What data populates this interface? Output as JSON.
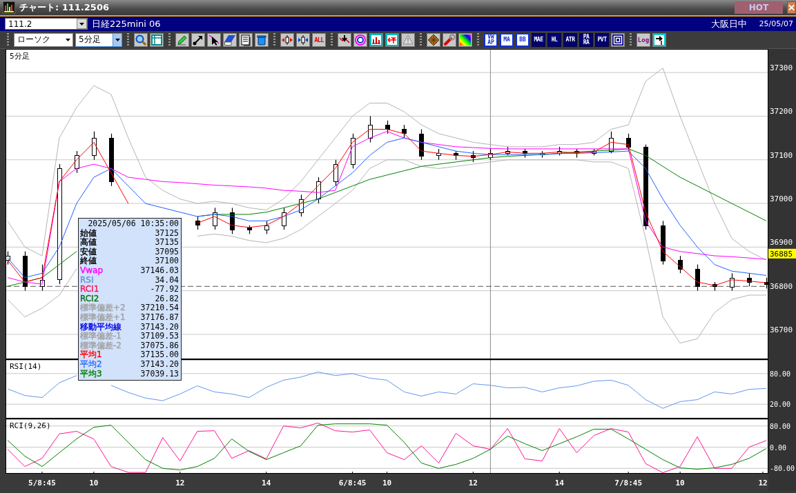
{
  "window": {
    "title": "チャート: 111.2506",
    "hot_button": "HOT"
  },
  "symbol_bar": {
    "symbol": "111.2",
    "name": "日経225mini 06",
    "session": "大阪日中",
    "date": "25/05/07"
  },
  "toolbar": {
    "dropdowns": [
      {
        "value": "ローソク",
        "focused": false
      },
      {
        "value": "5分足",
        "focused": true
      }
    ],
    "groups": [
      [
        {
          "kind": "icon"
        },
        {
          "kind": "icon"
        }
      ],
      [
        {
          "kind": "icon"
        },
        {
          "kind": "icon"
        },
        {
          "kind": "icon"
        },
        {
          "kind": "icon"
        },
        {
          "kind": "icon"
        },
        {
          "kind": "icon"
        }
      ],
      [
        {
          "kind": "icon"
        },
        {
          "kind": "icon"
        },
        {
          "kind": "warn",
          "label": "ALL"
        }
      ],
      [
        {
          "kind": "icon"
        },
        {
          "kind": "icon"
        },
        {
          "kind": "icon"
        },
        {
          "kind": "icon"
        },
        {
          "kind": "icon"
        }
      ],
      [
        {
          "kind": "icon"
        },
        {
          "kind": "icon"
        },
        {
          "kind": "icon"
        }
      ],
      [
        {
          "kind": "boxed",
          "label": "VW AP"
        },
        {
          "kind": "boxed",
          "label": "MA"
        },
        {
          "kind": "boxed",
          "label": "BB"
        },
        {
          "kind": "dark",
          "label": "MAE"
        },
        {
          "kind": "dark",
          "label": "HL"
        },
        {
          "kind": "dark",
          "label": "ATR"
        },
        {
          "kind": "dark",
          "label": "PA RA"
        },
        {
          "kind": "dark",
          "label": "PVT"
        },
        {
          "kind": "icon"
        }
      ],
      [
        {
          "kind": "plain",
          "label": "Log"
        },
        {
          "kind": "icon"
        }
      ]
    ]
  },
  "main_chart": {
    "chart_data": {
      "type": "candlestick",
      "title": "5分足",
      "grid": true,
      "categories": [
        null,
        null,
        null,
        null,
        null,
        null,
        null,
        null,
        null,
        null,
        null,
        null,
        null,
        null,
        null,
        null,
        null,
        null,
        null,
        null,
        null,
        null,
        null,
        null,
        null,
        null,
        null,
        null,
        null,
        null,
        null,
        null,
        null,
        null,
        null,
        null,
        null,
        null,
        null,
        null,
        null,
        null,
        null,
        null,
        null
      ],
      "ohlc": [
        [
          36870,
          36890,
          36860,
          36880
        ],
        [
          36880,
          36890,
          36800,
          36810
        ],
        [
          36810,
          36860,
          36800,
          36825
        ],
        [
          36825,
          37090,
          36815,
          37080
        ],
        [
          37080,
          37120,
          37070,
          37110
        ],
        [
          37110,
          37165,
          37100,
          37150
        ],
        [
          37150,
          37160,
          37040,
          37050
        ],
        null,
        null,
        null,
        null,
        [
          36960,
          36970,
          36940,
          36950
        ],
        [
          36950,
          36990,
          36940,
          36980
        ],
        [
          36980,
          36990,
          36930,
          36940
        ],
        [
          36945,
          36950,
          36930,
          36940
        ],
        [
          36940,
          36960,
          36930,
          36950
        ],
        [
          36950,
          36990,
          36940,
          36980
        ],
        [
          36980,
          37020,
          36970,
          37010
        ],
        [
          37010,
          37060,
          37000,
          37050
        ],
        [
          37050,
          37100,
          37040,
          37090
        ],
        [
          37090,
          37160,
          37080,
          37150
        ],
        [
          37150,
          37200,
          37140,
          37180
        ],
        [
          37180,
          37190,
          37160,
          37170
        ],
        [
          37170,
          37180,
          37150,
          37160
        ],
        [
          37160,
          37170,
          37100,
          37110
        ],
        [
          37110,
          37125,
          37100,
          37115
        ],
        [
          37115,
          37120,
          37100,
          37110
        ],
        [
          37110,
          37120,
          37095,
          37105
        ],
        [
          37105,
          37125,
          37100,
          37115
        ],
        [
          37115,
          37130,
          37110,
          37120
        ],
        [
          37120,
          37125,
          37105,
          37115
        ],
        [
          37112,
          37120,
          37105,
          37115
        ],
        [
          37115,
          37130,
          37110,
          37120
        ],
        [
          37120,
          37125,
          37105,
          37115
        ],
        [
          37115,
          37125,
          37110,
          37120
        ],
        [
          37120,
          37165,
          37115,
          37150
        ],
        [
          37150,
          37160,
          37120,
          37130
        ],
        [
          37130,
          37135,
          36940,
          36950
        ],
        [
          36950,
          36960,
          36860,
          36870
        ],
        [
          36870,
          36880,
          36840,
          36850
        ],
        [
          36850,
          36860,
          36800,
          36810
        ],
        [
          36815,
          36820,
          36800,
          36810
        ],
        [
          36810,
          36840,
          36800,
          36830
        ],
        [
          36830,
          36840,
          36810,
          36820
        ],
        [
          36820,
          36830,
          36805,
          36815
        ]
      ],
      "ylim": [
        36643,
        37354
      ],
      "yticks": [
        36700,
        36800,
        36900,
        37000,
        37100,
        37200,
        37300
      ],
      "ref_lines": [
        {
          "axis": "y",
          "value": 36810
        }
      ],
      "annotations": [
        {
          "text": "36885",
          "y": 36885
        }
      ]
    }
  },
  "main_overlay": {
    "chart_data": {
      "type": "line",
      "categories": [
        null,
        null,
        null,
        null,
        null,
        null,
        null,
        null,
        null,
        null,
        null,
        null,
        null,
        null,
        null,
        null,
        null,
        null,
        null,
        null,
        null,
        null,
        null,
        null,
        null,
        null,
        null,
        null,
        null,
        null,
        null,
        null,
        null,
        null,
        null,
        null,
        null,
        null,
        null,
        null,
        null,
        null,
        null,
        null,
        null
      ],
      "series": [
        {
          "color": "#b4b4b4",
          "values": [
            36960,
            36900,
            36880,
            37150,
            37220,
            37270,
            37250,
            37150,
            37060,
            37030,
            37010,
            37000,
            37005,
            37000,
            36990,
            36985,
            37010,
            37050,
            37100,
            37150,
            37200,
            37230,
            37230,
            37210,
            37180,
            37160,
            37150,
            37140,
            37135,
            37130,
            37130,
            37130,
            37135,
            37135,
            37140,
            37170,
            37180,
            37280,
            37310,
            37200,
            37100,
            37000,
            36920,
            36890,
            36870
          ]
        },
        {
          "color": "#b4b4b4",
          "values": [
            36780,
            36740,
            36760,
            36790,
            36850,
            null,
            null,
            null,
            null,
            null,
            null,
            36925,
            36930,
            36925,
            36915,
            36910,
            36920,
            36940,
            36970,
            37000,
            37030,
            37080,
            37100,
            37100,
            37085,
            37080,
            37085,
            37090,
            37095,
            37100,
            37100,
            37100,
            37100,
            37100,
            37095,
            37095,
            37080,
            36920,
            36740,
            36680,
            36690,
            36750,
            36780,
            36790,
            36790
          ]
        },
        {
          "color": "#008000",
          "values": [
            36810,
            36820,
            36830,
            36860,
            36890,
            null,
            null,
            null,
            null,
            null,
            null,
            36970,
            36975,
            36975,
            36975,
            36980,
            36990,
            37000,
            37010,
            37025,
            37040,
            37055,
            37065,
            37075,
            37085,
            37090,
            37095,
            37100,
            37105,
            37108,
            37110,
            37112,
            37115,
            37118,
            37120,
            37122,
            37125,
            37110,
            37085,
            37060,
            37040,
            37020,
            37000,
            36980,
            36960
          ]
        },
        {
          "color": "#ff00ff",
          "values": [
            36830,
            36820,
            36815,
            37050,
            37080,
            37090,
            37080,
            37060,
            37055,
            37050,
            37048,
            37045,
            37042,
            37040,
            37038,
            37035,
            37030,
            37028,
            37025,
            37030,
            37130,
            37150,
            37165,
            37150,
            37140,
            37135,
            37130,
            37128,
            37126,
            37125,
            37125,
            37125,
            37125,
            37125,
            37125,
            37125,
            37125,
            36960,
            36900,
            36890,
            36885,
            36880,
            36878,
            36875,
            36872
          ]
        },
        {
          "color": "#2060ff",
          "values": [
            36875,
            36830,
            36840,
            36900,
            37000,
            37060,
            37080,
            37040,
            37000,
            36990,
            36980,
            36970,
            36975,
            36970,
            36960,
            36960,
            36970,
            36985,
            37010,
            37040,
            37070,
            37110,
            37140,
            37150,
            37140,
            37130,
            37120,
            37115,
            37112,
            37112,
            37112,
            37112,
            37114,
            37115,
            37116,
            37118,
            37120,
            37080,
            37010,
            36950,
            36900,
            36860,
            36845,
            36840,
            36835
          ]
        },
        {
          "color": "#ff0000",
          "values": [
            36870,
            36820,
            36830,
            37050,
            37100,
            37140,
            37070,
            37000,
            null,
            null,
            null,
            36955,
            36970,
            36950,
            36945,
            36950,
            36970,
            37000,
            37040,
            37080,
            37140,
            37170,
            37170,
            37160,
            37120,
            37115,
            37110,
            37108,
            37112,
            37118,
            37115,
            37115,
            37118,
            37116,
            37118,
            37140,
            37135,
            36980,
            36890,
            36855,
            36820,
            36812,
            36825,
            36822,
            36818
          ]
        }
      ],
      "ylim": [
        36643,
        37354
      ]
    }
  },
  "rsi_panel": {
    "chart_data": {
      "type": "line",
      "title": "RSI(14)",
      "grid": true,
      "categories": [
        null,
        null,
        null,
        null,
        null,
        null,
        null,
        null,
        null,
        null,
        null,
        null,
        null,
        null,
        null,
        null,
        null,
        null,
        null,
        null,
        null,
        null,
        null,
        null,
        null,
        null,
        null,
        null,
        null,
        null,
        null,
        null,
        null,
        null,
        null,
        null,
        null,
        null,
        null,
        null,
        null,
        null,
        null,
        null,
        null
      ],
      "series": [
        {
          "color": "#6495ed",
          "values": [
            50,
            37,
            33,
            62,
            76,
            null,
            57,
            43,
            32,
            27,
            40,
            56,
            44,
            40,
            33,
            53,
            67,
            73,
            83,
            76,
            80,
            71,
            67,
            44,
            36,
            44,
            40,
            60,
            57,
            52,
            53,
            44,
            52,
            56,
            65,
            67,
            57,
            29,
            12,
            25,
            29,
            44,
            40,
            49,
            51
          ]
        }
      ],
      "ylim": [
        -8,
        108
      ],
      "yticks": [
        {
          "value": 80,
          "label": "80.00"
        },
        {
          "value": 20,
          "label": "20.00"
        }
      ]
    }
  },
  "rci_panel": {
    "chart_data": {
      "type": "line",
      "title": "RCI(9,26)",
      "grid": true,
      "categories": [
        null,
        null,
        "5/8:45",
        null,
        null,
        "10",
        null,
        null,
        null,
        null,
        "12",
        null,
        null,
        null,
        null,
        "14",
        null,
        null,
        null,
        null,
        "6/8:45",
        null,
        "10",
        null,
        null,
        null,
        null,
        "12",
        null,
        null,
        null,
        null,
        "14",
        null,
        null,
        null,
        "7/8:45",
        null,
        null,
        "10",
        null,
        null,
        null,
        null,
        "12"
      ],
      "series": [
        {
          "color": "#ff1493",
          "values": [
            -8,
            -73,
            -42,
            50,
            60,
            31,
            -73,
            -95,
            -95,
            36,
            -52,
            60,
            62,
            -42,
            -13,
            -44,
            80,
            73,
            91,
            62,
            57,
            65,
            -21,
            -47,
            5,
            -60,
            52,
            5,
            -8,
            70,
            -44,
            -52,
            70,
            -21,
            44,
            70,
            57,
            -62,
            -96,
            -73,
            39,
            -80,
            -80,
            0,
            25
          ]
        },
        {
          "color": "#008000",
          "values": [
            26,
            -34,
            -73,
            -21,
            31,
            75,
            83,
            18,
            -47,
            -80,
            -86,
            -73,
            -42,
            31,
            -16,
            -47,
            -21,
            5,
            83,
            88,
            88,
            88,
            83,
            18,
            -60,
            -80,
            -65,
            -42,
            -8,
            42,
            13,
            -13,
            13,
            39,
            68,
            68,
            31,
            -8,
            -47,
            -78,
            -83,
            -78,
            -65,
            -42,
            -5
          ]
        }
      ],
      "ylim": [
        -100,
        108
      ],
      "yticks": [
        {
          "value": 80,
          "label": "80.00"
        },
        {
          "value": 0,
          "label": "0.00"
        },
        {
          "value": -80,
          "label": "-80.00"
        }
      ]
    }
  },
  "info_box": {
    "datetime": "2025/05/06 10:35:00",
    "rows": [
      {
        "label": "始値",
        "value": "37125",
        "color": "#000000"
      },
      {
        "label": "高値",
        "value": "37135",
        "color": "#000000"
      },
      {
        "label": "安値",
        "value": "37095",
        "color": "#000000"
      },
      {
        "label": "終値",
        "value": "37100",
        "color": "#000000"
      },
      {
        "label": "Vwap",
        "value": "37146.03",
        "color": "#ff00ff"
      },
      {
        "label": "RSI",
        "value": "34.04",
        "color": "#6a8fd8"
      },
      {
        "label": "RCI1",
        "value": "-77.92",
        "color": "#ff1060"
      },
      {
        "label": "RCI2",
        "value": "26.82",
        "color": "#107010"
      },
      {
        "label": "標準偏差+2",
        "value": "37210.54",
        "color": "#a0a0a0"
      },
      {
        "label": "標準偏差+1",
        "value": "37176.87",
        "color": "#a0a0a0"
      },
      {
        "label": "移動平均線",
        "value": "37143.20",
        "color": "#0000e0"
      },
      {
        "label": "標準偏差-1",
        "value": "37109.53",
        "color": "#a0a0a0"
      },
      {
        "label": "標準偏差-2",
        "value": "37075.86",
        "color": "#a0a0a0"
      },
      {
        "label": "平均1",
        "value": "37135.00",
        "color": "#ff0000"
      },
      {
        "label": "平均2",
        "value": "37143.20",
        "color": "#3070ff"
      },
      {
        "label": "平均3",
        "value": "37039.13",
        "color": "#008000"
      }
    ]
  }
}
